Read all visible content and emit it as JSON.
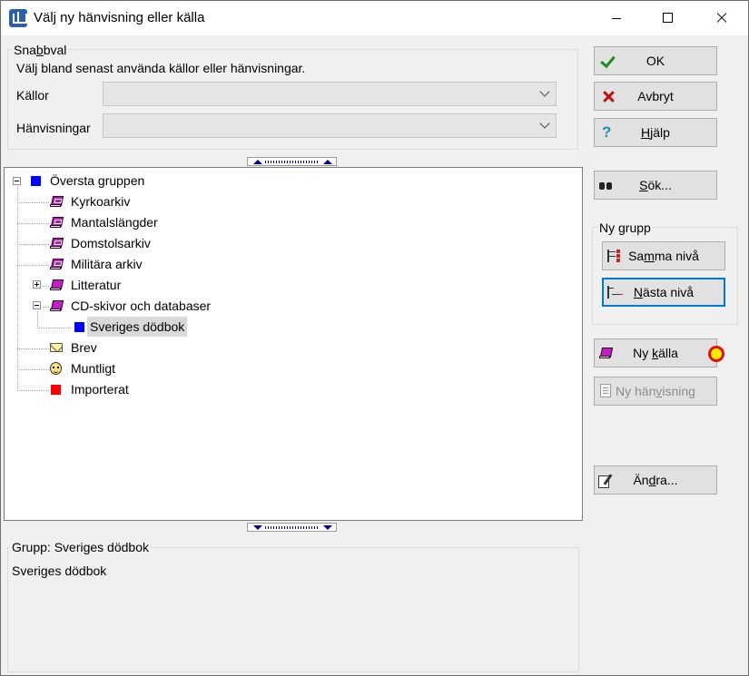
{
  "window": {
    "title": "Välj ny hänvisning eller källa"
  },
  "quick": {
    "legend_pre": "Sna",
    "legend_ul": "b",
    "legend_post": "bval",
    "description": "Välj bland senast använda källor eller hänvisningar.",
    "sources_label": "Källor",
    "sources_value": "",
    "references_label": "Hänvisningar",
    "references_value": ""
  },
  "tree": [
    {
      "label": "Översta gruppen",
      "icon": "blue-square-icon"
    },
    {
      "label": "Kyrkoarkiv",
      "icon": "archive-book-icon"
    },
    {
      "label": "Mantalslängder",
      "icon": "archive-book-icon"
    },
    {
      "label": "Domstolsarkiv",
      "icon": "archive-book-icon"
    },
    {
      "label": "Militära arkiv",
      "icon": "archive-book-icon"
    },
    {
      "label": "Litteratur",
      "icon": "book-icon"
    },
    {
      "label": "CD-skivor och databaser",
      "icon": "book-icon"
    },
    {
      "label": "Sveriges dödbok",
      "icon": "blue-square-icon"
    },
    {
      "label": "Brev",
      "icon": "envelope-icon"
    },
    {
      "label": "Muntligt",
      "icon": "face-icon"
    },
    {
      "label": "Importerat",
      "icon": "red-square-icon"
    }
  ],
  "info": {
    "legend": "Grupp: Sveriges dödbok",
    "text": "Sveriges dödbok"
  },
  "buttons": {
    "ok": "OK",
    "cancel": "Avbryt",
    "help_ul": "H",
    "help_post": "jälp",
    "search_ul": "S",
    "search_post": "ök...",
    "new_group_legend": "Ny grupp",
    "same_pre": "Sa",
    "same_ul": "m",
    "same_post": "ma nivå",
    "next_ul": "N",
    "next_post": "ästa nivå",
    "new_source_pre": "Ny ",
    "new_source_ul": "k",
    "new_source_post": "älla",
    "new_ref_pre": "Ny hän",
    "new_ref_ul": "v",
    "new_ref_post": "isning",
    "edit_pre": "Än",
    "edit_ul": "d",
    "edit_post": "ra..."
  },
  "colors": {
    "focus": "#0078d7",
    "blue_square": "#0000ff",
    "red_square": "#ff0000",
    "marker": "#ffea00"
  }
}
